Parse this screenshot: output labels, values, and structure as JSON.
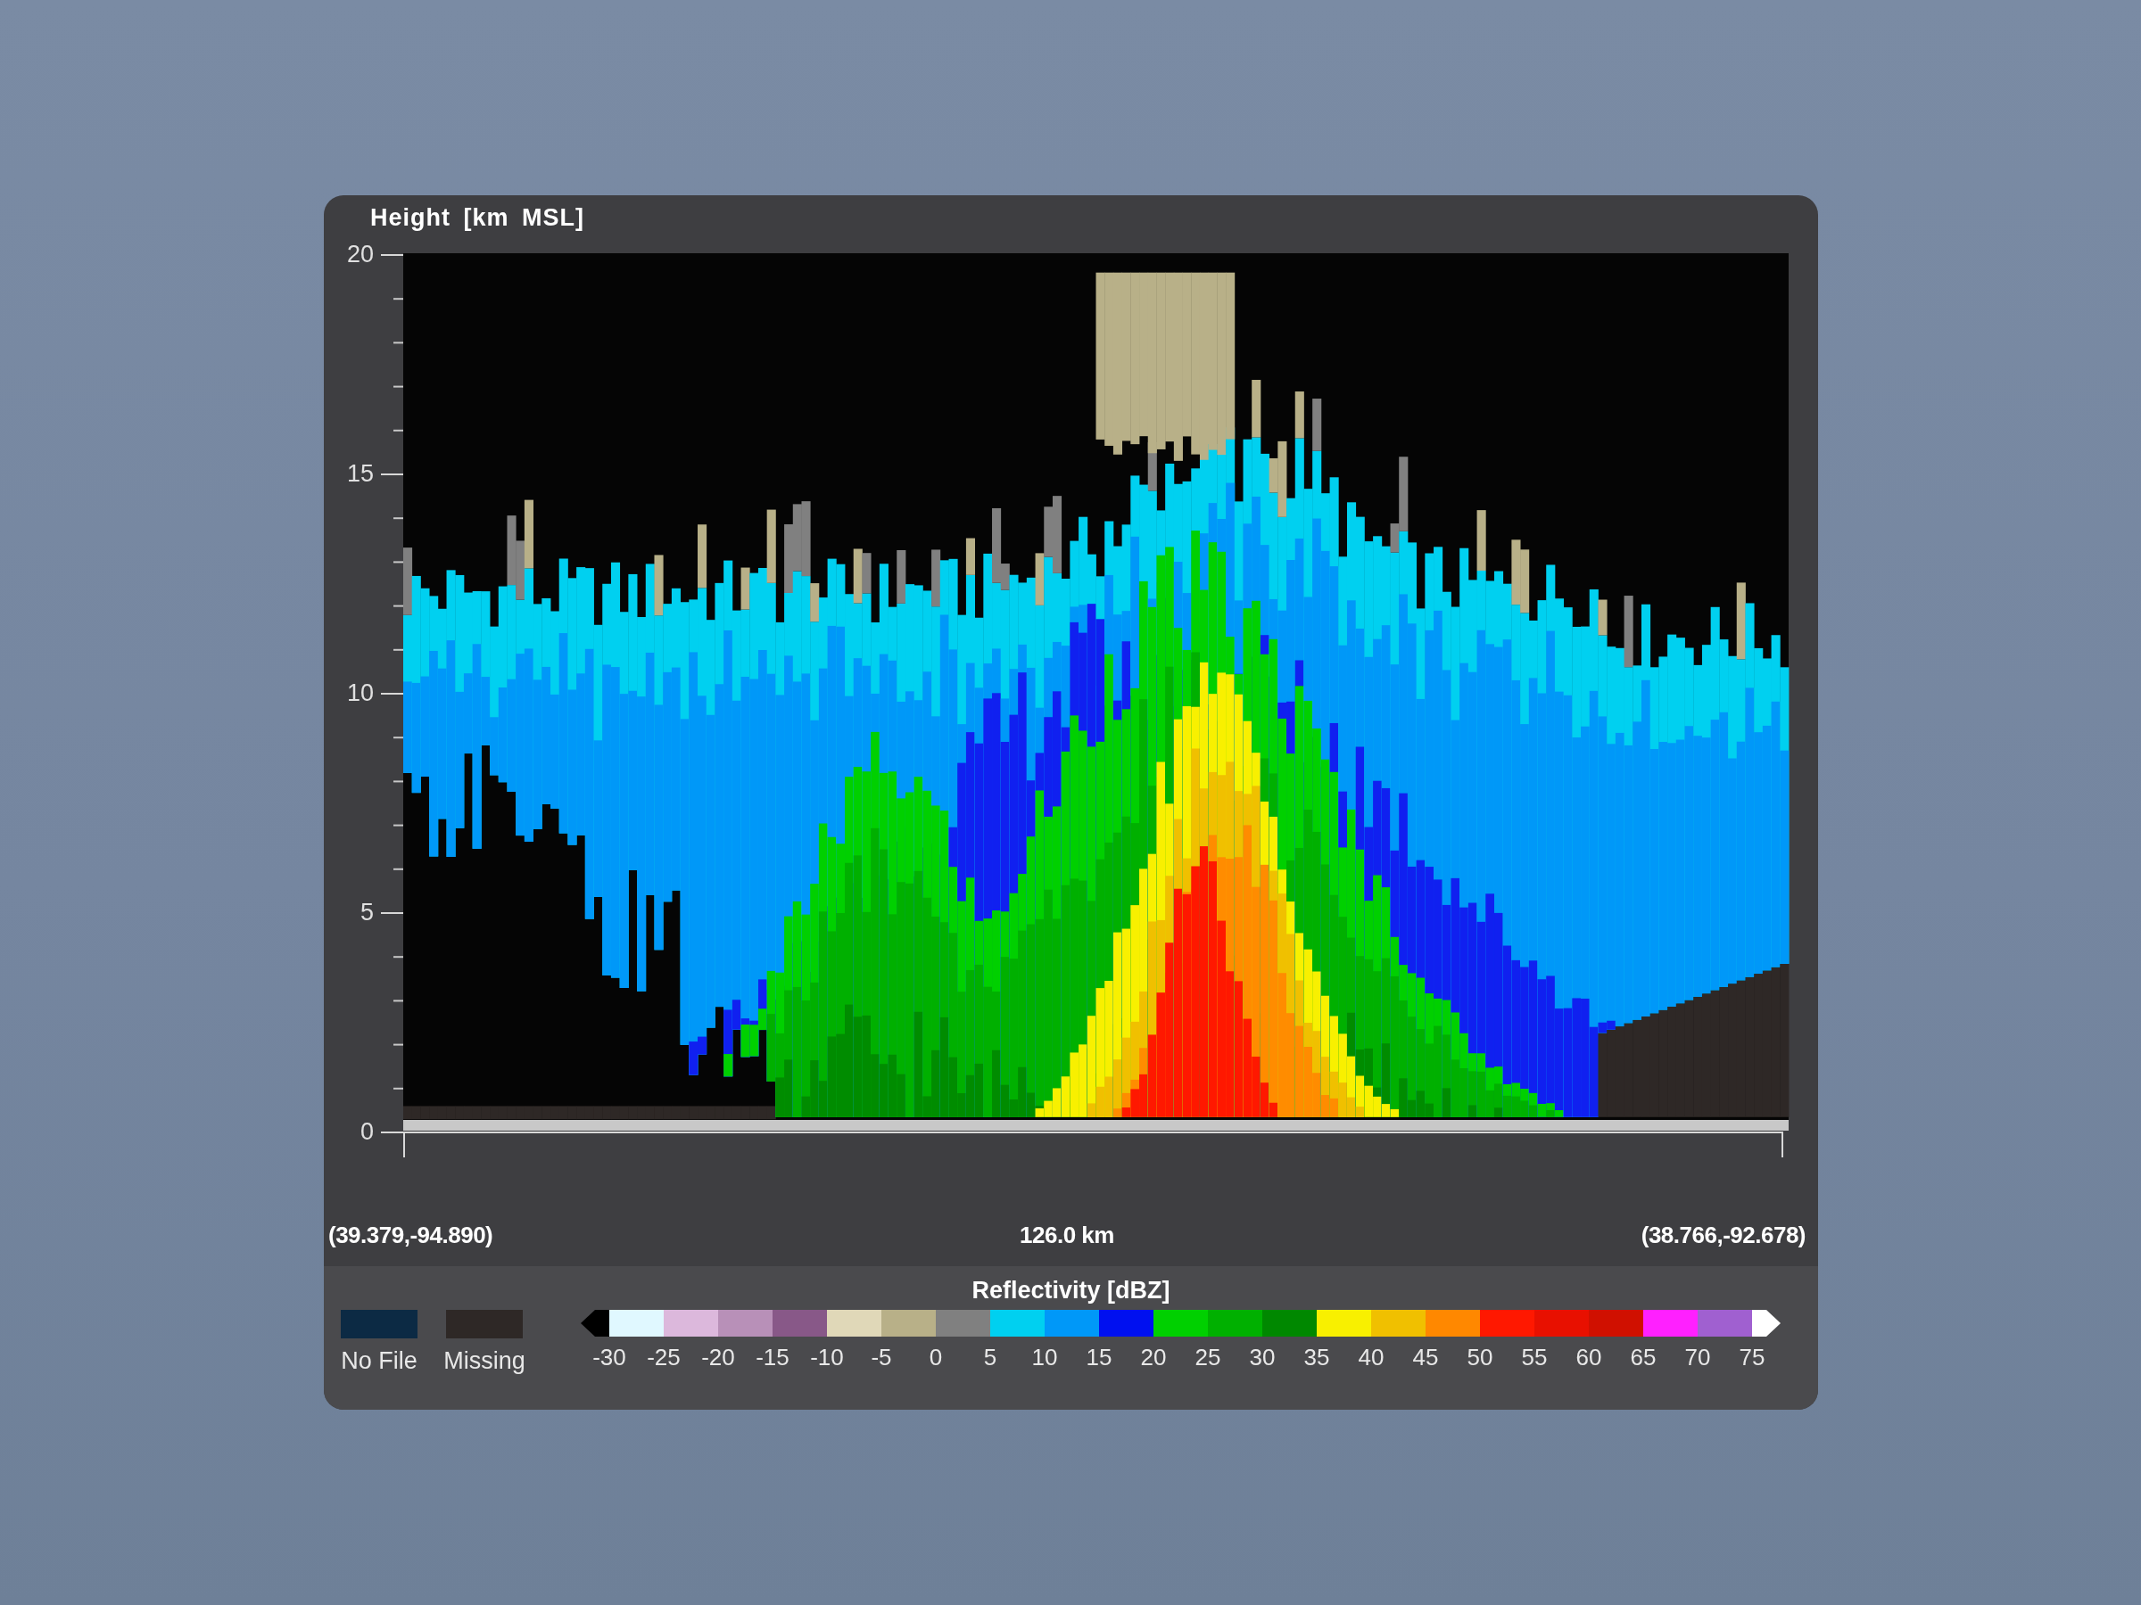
{
  "plot": {
    "title": "Height [km MSL]",
    "y_ticks": [
      "20",
      "15",
      "10",
      "5",
      "0"
    ]
  },
  "footer": {
    "start": "(39.379,-94.890)",
    "distance": "126.0 km",
    "end": "(38.766,-92.678)"
  },
  "legend": {
    "title": "Reflectivity [dBZ]",
    "specials": [
      {
        "label": "No File",
        "color": "#0c2a44"
      },
      {
        "label": "Missing",
        "color": "#2e2826"
      }
    ],
    "segments": [
      {
        "kind": "start-arrow",
        "color": "#000000"
      },
      {
        "kind": "band",
        "color": "#e0f8ff"
      },
      {
        "kind": "band",
        "color": "#dcb8dc"
      },
      {
        "kind": "band",
        "color": "#b890b8"
      },
      {
        "kind": "band",
        "color": "#885888"
      },
      {
        "kind": "band",
        "color": "#e0d8b8"
      },
      {
        "kind": "band",
        "color": "#b8b088"
      },
      {
        "kind": "band",
        "color": "#808080"
      },
      {
        "kind": "band",
        "color": "#00d0f0"
      },
      {
        "kind": "band",
        "color": "#0098f8"
      },
      {
        "kind": "band",
        "color": "#0010f0"
      },
      {
        "kind": "band",
        "color": "#00d000"
      },
      {
        "kind": "band",
        "color": "#00b000"
      },
      {
        "kind": "band",
        "color": "#008800"
      },
      {
        "kind": "band",
        "color": "#f8f000"
      },
      {
        "kind": "band",
        "color": "#f0c000"
      },
      {
        "kind": "band",
        "color": "#ff8800"
      },
      {
        "kind": "band",
        "color": "#ff1800"
      },
      {
        "kind": "band",
        "color": "#e81000"
      },
      {
        "kind": "band",
        "color": "#d01000"
      },
      {
        "kind": "band",
        "color": "#ff20ff"
      },
      {
        "kind": "band",
        "color": "#a060d0"
      },
      {
        "kind": "end-arrow",
        "color": "#ffffff"
      }
    ],
    "labels": [
      "-30",
      "-25",
      "-20",
      "-15",
      "-10",
      "-5",
      "0",
      "5",
      "10",
      "15",
      "20",
      "25",
      "30",
      "35",
      "40",
      "45",
      "50",
      "55",
      "60",
      "65",
      "70",
      "75"
    ]
  }
}
